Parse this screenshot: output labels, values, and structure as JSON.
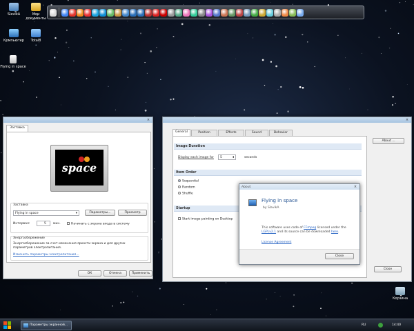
{
  "colors": {
    "accent": "#2a66c4",
    "desktop_bg": "#0b1220",
    "window_bg": "#f0f0f0",
    "section_header": "#dfe9f5"
  },
  "desktop": {
    "icons": [
      {
        "label": "SlavikA",
        "icon": "user-folder-icon"
      },
      {
        "label": "Мои документы",
        "icon": "documents-folder-icon"
      },
      {
        "label": "Компьютер",
        "icon": "computer-icon"
      },
      {
        "label": "Total8",
        "icon": "total-commander-icon"
      },
      {
        "label": "Flying in space",
        "icon": "screensaver-file-icon"
      },
      {
        "label": "Корзина",
        "icon": "recycle-bin-icon"
      }
    ]
  },
  "dock": {
    "icons": [
      "user-icon",
      "chrome-icon",
      "opera-icon",
      "firefox-icon",
      "yandex-icon",
      "skype-icon",
      "skype-alt-icon",
      "app-icon",
      "app-icon",
      "app-icon",
      "photoshop-icon",
      "photoshop-icon",
      "app-icon",
      "media-icon",
      "media-icon",
      "app-icon",
      "app-icon",
      "app-icon",
      "app-icon",
      "app-icon",
      "app-icon",
      "app-icon",
      "app-icon",
      "app-icon",
      "app-icon",
      "app-icon",
      "app-icon",
      "app-icon",
      "app-icon",
      "app-icon",
      "app-icon",
      "app-icon",
      "app-icon"
    ]
  },
  "screensaver_dialog": {
    "tab": "Заставка",
    "preview_logo": "space",
    "screensaver_group": "Заставка",
    "selected_screensaver": "Flying in space",
    "params_button": "Параметры...",
    "preview_button": "Просмотр",
    "interval_label": "Интервал:",
    "interval_value": "5",
    "interval_unit": "мин.",
    "checkbox_label": "Начинать с экрана входа в систему",
    "power_group": "Энергосбережение",
    "power_text": "Энергосбережение за счет изменения яркости экрана и для других параметров электропитания.",
    "power_link": "Изменить параметры электропитания...",
    "ok_button": "ОК",
    "cancel_button": "Отмена",
    "apply_button": "Применить"
  },
  "settings_window": {
    "tabs": [
      "General",
      "Position",
      "Effects",
      "Sound",
      "Behavior"
    ],
    "about_button": "About ...",
    "image_duration_header": "Image Duration",
    "display_label": "Display each image for",
    "display_value": "5",
    "display_unit": "seconds",
    "item_order_header": "Item Order",
    "order_options": [
      "Sequential",
      "Random",
      "Shuffle"
    ],
    "order_selected": "Sequential",
    "startup_header": "Startup",
    "startup_checkbox": "Start image painting on Desktop",
    "close_button": "Close"
  },
  "about_dialog": {
    "title": "About",
    "app_name": "Flying in space",
    "author": "by SlavikA",
    "desc_1": "This software uses code of ",
    "desc_link_1": "FFmpeg",
    "desc_2": " licensed under the",
    "desc_link_2": "LGPLv2.1",
    "desc_3": " and its source can be downloaded ",
    "desc_link_3": "here",
    "license_link": "License Agreement",
    "close_button": "Close"
  },
  "taskbar": {
    "start_icon": "windows-logo-icon",
    "task_label": "Параметры экранной...",
    "language": "RU",
    "time": "14:40"
  }
}
